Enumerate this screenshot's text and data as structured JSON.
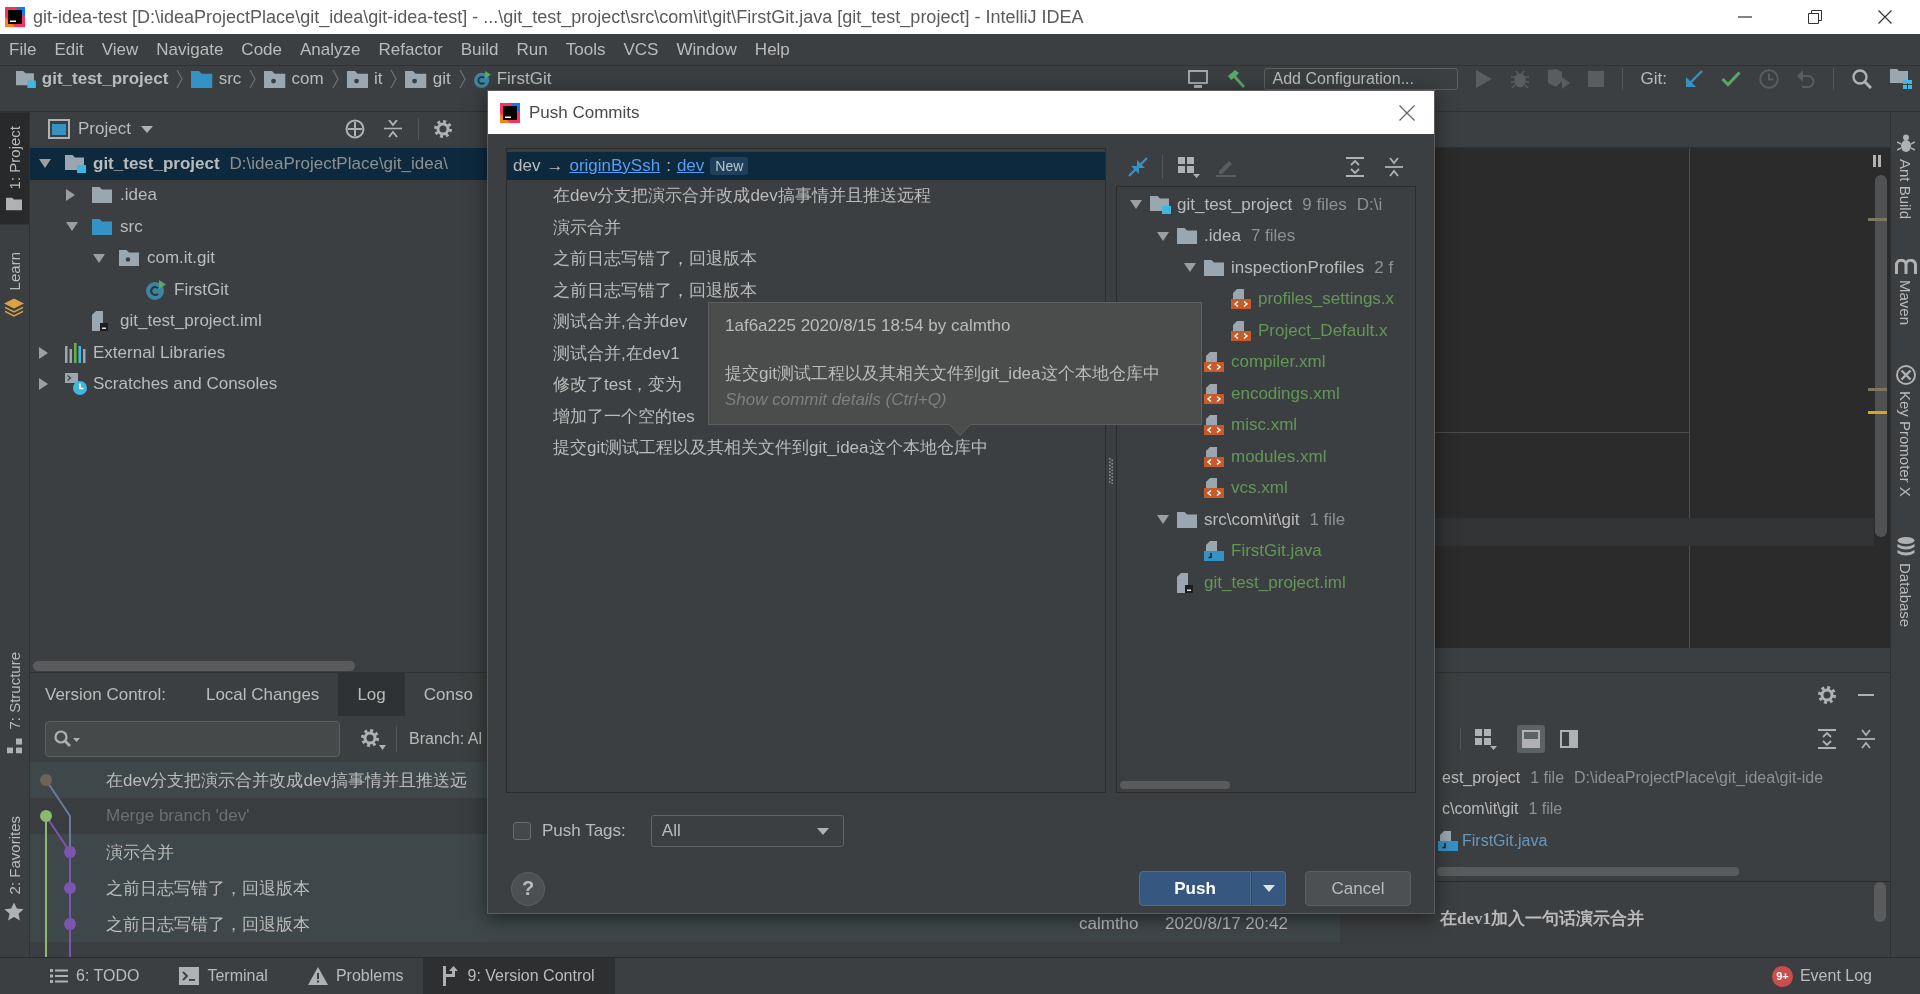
{
  "window": {
    "title": "git-idea-test [D:\\ideaProjectPlace\\git_idea\\git-idea-test] - ...\\git_test_project\\src\\com\\it\\git\\FirstGit.java [git_test_project] - IntelliJ IDEA"
  },
  "menu": [
    "File",
    "Edit",
    "View",
    "Navigate",
    "Code",
    "Analyze",
    "Refactor",
    "Build",
    "Run",
    "Tools",
    "VCS",
    "Window",
    "Help"
  ],
  "navbar": {
    "breadcrumb": [
      {
        "label": "git_test_project",
        "kind": "module"
      },
      {
        "label": "src",
        "kind": "source"
      },
      {
        "label": "com",
        "kind": "package"
      },
      {
        "label": "it",
        "kind": "package"
      },
      {
        "label": "git",
        "kind": "package"
      },
      {
        "label": "FirstGit",
        "kind": "class"
      }
    ],
    "run_configuration": "Add Configuration...",
    "vcs_label": "Git:"
  },
  "left_toolstrip": {
    "top": [
      {
        "label": "1: Project",
        "kind": "project",
        "selected": true
      },
      {
        "label": "Learn",
        "kind": "learn",
        "selected": false
      }
    ],
    "bottom": [
      {
        "label": "7: Structure",
        "kind": "structure",
        "selected": false
      },
      {
        "label": "2: Favorites",
        "kind": "favorites",
        "selected": false
      }
    ]
  },
  "right_toolstrip": [
    {
      "label": "Ant Build",
      "kind": "ant"
    },
    {
      "label": "Maven",
      "kind": "maven"
    },
    {
      "label": "Key Promoter X",
      "kind": "keypromoter"
    },
    {
      "label": "Database",
      "kind": "database"
    }
  ],
  "project_panel": {
    "title": "Project",
    "tree": [
      {
        "label": "git_test_project",
        "path": "D:\\ideaProjectPlace\\git_idea\\",
        "kind": "module",
        "expanded": true,
        "selected": true,
        "children": [
          {
            "label": ".idea",
            "kind": "folder",
            "expanded": false,
            "selected": false
          },
          {
            "label": "src",
            "kind": "source",
            "expanded": true,
            "selected": false,
            "children": [
              {
                "label": "com.it.git",
                "kind": "package",
                "expanded": true,
                "selected": false,
                "children": [
                  {
                    "label": "FirstGit",
                    "kind": "class",
                    "selected": false
                  }
                ]
              }
            ]
          },
          {
            "label": "git_test_project.iml",
            "kind": "iml",
            "selected": false
          }
        ]
      },
      {
        "label": "External Libraries",
        "kind": "libraries",
        "expanded": false,
        "selected": false
      },
      {
        "label": "Scratches and Consoles",
        "kind": "scratches",
        "expanded": false,
        "selected": false
      }
    ]
  },
  "vcs_panel": {
    "title": "Version Control:",
    "tabs": [
      {
        "label": "Local Changes",
        "selected": false
      },
      {
        "label": "Log",
        "selected": true
      },
      {
        "label": "Conso",
        "selected": false
      }
    ],
    "branch_filter": "Branch: Al",
    "log": [
      {
        "message": "在dev分支把演示合并改成dev搞事情并且推送远",
        "dimmed": false,
        "kind": "trunk",
        "color": "#6e6458"
      },
      {
        "message": "Merge branch 'dev'",
        "dimmed": true,
        "kind": "trunk",
        "color": "#8db870"
      },
      {
        "message": "演示合并",
        "dimmed": false,
        "kind": "branch",
        "color": "#7c55b0"
      },
      {
        "message": "之前日志写错了，回退版本",
        "dimmed": false,
        "kind": "branch",
        "color": "#7c55b0"
      },
      {
        "message": "之前日志写错了，回退版本",
        "dimmed": false,
        "kind": "branch",
        "color": "#7c55b0",
        "author": "calmtho",
        "date": "2020/8/17 20:42"
      }
    ],
    "view_toggles": [
      {
        "selected": true
      },
      {
        "selected": false
      }
    ],
    "changes": [
      {
        "label": "est_project",
        "count": "1 file",
        "path": "D:\\ideaProjectPlace\\git_idea\\git-ide",
        "children": [
          {
            "label": "c\\com\\it\\git",
            "count": "1 file",
            "children": [
              {
                "label": "FirstGit.java",
                "kind": "java",
                "color": "#6897bb"
              }
            ]
          }
        ]
      }
    ],
    "commit_details": "在dev1加入一句话演示合并"
  },
  "status_bar": {
    "tools": [
      {
        "label": "6: TODO",
        "kind": "todo",
        "selected": false
      },
      {
        "label": "Terminal",
        "kind": "terminal",
        "selected": false
      },
      {
        "label": "Problems",
        "kind": "problems",
        "selected": false
      },
      {
        "label": "9: Version Control",
        "kind": "vcs",
        "selected": true
      }
    ],
    "event_log": {
      "label": "Event Log",
      "badge": "9+"
    }
  },
  "dialog": {
    "title": "Push Commits",
    "branch": {
      "source": "dev",
      "arrow": "→",
      "remote": "originBySsh",
      "separator": ":",
      "target": "dev",
      "badge": "New",
      "selected": true
    },
    "commits": [
      "在dev分支把演示合并改成dev搞事情并且推送远程",
      "演示合并",
      "之前日志写错了，回退版本",
      "之前日志写错了，回退版本",
      "测试合并,合并dev",
      "测试合并,在dev1",
      "修改了test，变为",
      "增加了一个空的tes",
      "提交git测试工程以及其相关文件到git_idea这个本地仓库中"
    ],
    "tooltip": {
      "header": "1af6a225 2020/8/15 18:54 by calmtho",
      "message": "提交git测试工程以及其相关文件到git_idea这个本地仓库中",
      "hint": "Show commit details (Ctrl+Q)"
    },
    "files": [
      {
        "label": "git_test_project",
        "kind": "module",
        "count": "9 files",
        "path": "D:\\i",
        "expanded": true,
        "children": [
          {
            "label": ".idea",
            "kind": "folder",
            "count": "7 files",
            "expanded": true,
            "children": [
              {
                "label": "inspectionProfiles",
                "kind": "folder",
                "count": "2 f",
                "expanded": true,
                "children": [
                  {
                    "label": "profiles_settings.x",
                    "kind": "xml",
                    "color": "#629755"
                  },
                  {
                    "label": "Project_Default.x",
                    "kind": "xml",
                    "color": "#629755"
                  }
                ]
              },
              {
                "label": "compiler.xml",
                "kind": "xml",
                "color": "#629755"
              },
              {
                "label": "encodings.xml",
                "kind": "xml",
                "color": "#629755"
              },
              {
                "label": "misc.xml",
                "kind": "xml",
                "color": "#629755"
              },
              {
                "label": "modules.xml",
                "kind": "xml",
                "color": "#629755"
              },
              {
                "label": "vcs.xml",
                "kind": "xml",
                "color": "#629755"
              }
            ]
          },
          {
            "label": "src\\com\\it\\git",
            "kind": "folder",
            "count": "1 file",
            "expanded": true,
            "children": [
              {
                "label": "FirstGit.java",
                "kind": "java",
                "color": "#629755"
              }
            ]
          },
          {
            "label": "git_test_project.iml",
            "kind": "iml",
            "color": "#629755"
          }
        ]
      }
    ],
    "push_tags": {
      "label": "Push Tags:",
      "checked": false,
      "value": "All"
    },
    "help": "?",
    "buttons": [
      {
        "label": "Push",
        "kind": "primary"
      },
      {
        "label": "Cancel",
        "kind": "secondary"
      }
    ]
  }
}
